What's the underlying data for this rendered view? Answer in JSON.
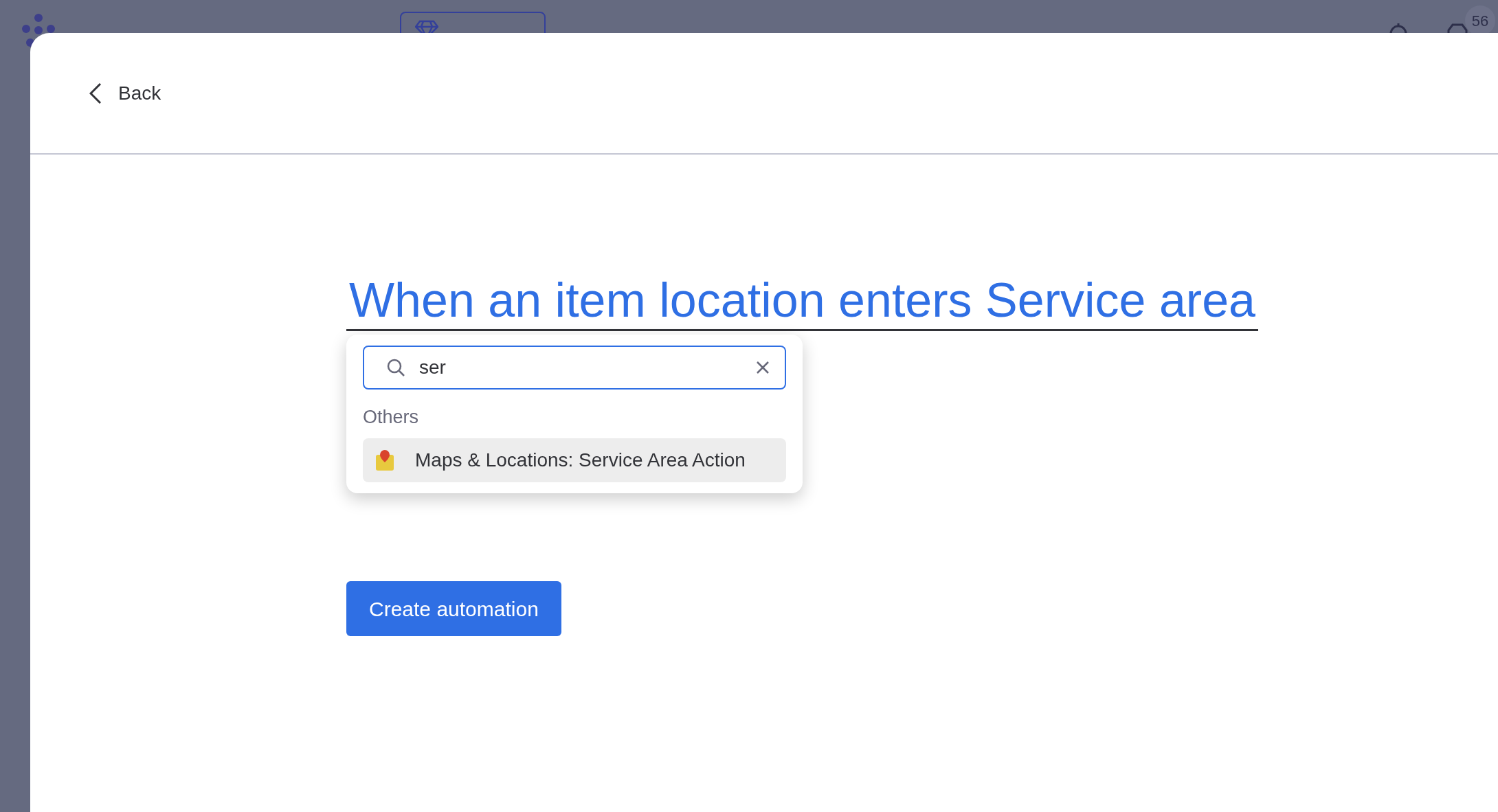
{
  "top_bar": {
    "badge": "56"
  },
  "modal": {
    "back": "Back",
    "trigger": "When an item location enters Service area",
    "button": "Create automation",
    "dropdown": {
      "search": {
        "value": "ser"
      },
      "groups": [
        {
          "title": "Others",
          "items": [
            {
              "label": "Maps & Locations: Service Area Action",
              "selected": true
            }
          ]
        }
      ]
    }
  }
}
